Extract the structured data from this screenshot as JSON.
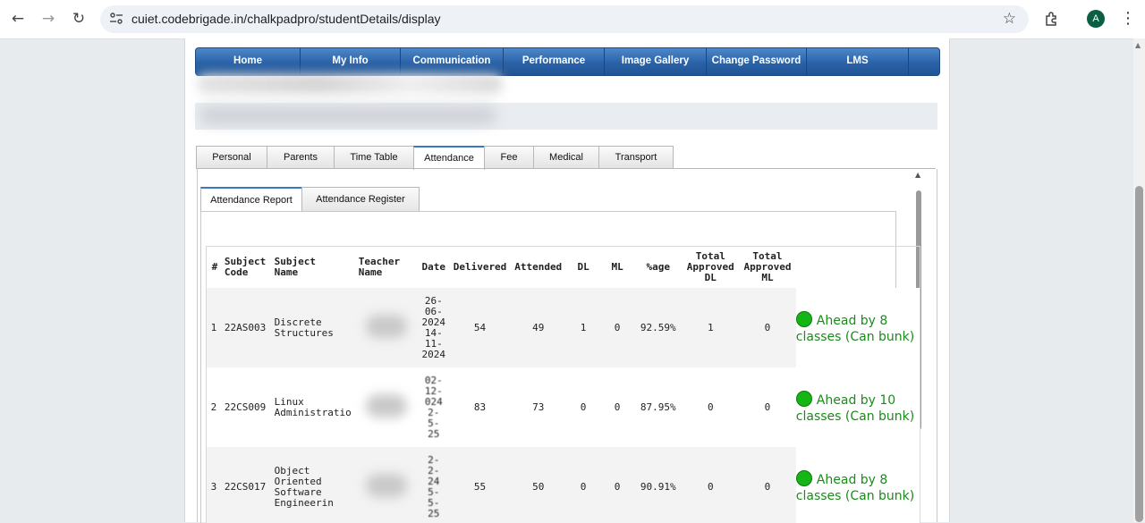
{
  "browser": {
    "url": "cuiet.codebrigade.in/chalkpadpro/studentDetails/display",
    "avatar_letter": "A"
  },
  "menu": [
    "Home",
    "My Info",
    "Communication",
    "Performance",
    "Image Gallery",
    "Change Password",
    "LMS"
  ],
  "tabs": [
    "Personal",
    "Parents",
    "Time Table",
    "Attendance",
    "Fee",
    "Medical",
    "Transport"
  ],
  "active_tab": "Attendance",
  "subtabs": [
    "Attendance Report",
    "Attendance Register"
  ],
  "table": {
    "headers": {
      "num": "#",
      "code": [
        "Subject",
        "Code"
      ],
      "name": [
        "Subject",
        "Name"
      ],
      "teacher": [
        "Teacher",
        "Name"
      ],
      "date": "Date",
      "delivered": "Delivered",
      "attended": "Attended",
      "dl": "DL",
      "ml": "ML",
      "pct": "%age",
      "tdl": [
        "Total",
        "Approved",
        "DL"
      ],
      "tml": [
        "Total",
        "Approved",
        "ML"
      ]
    },
    "rows": [
      {
        "num": "1",
        "code": "22AS003",
        "name": [
          "Discrete",
          "Structures"
        ],
        "date": [
          "26-",
          "06-",
          "2024",
          "14-",
          "11-",
          "2024"
        ],
        "delivered": "54",
        "attended": "49",
        "dl": "1",
        "ml": "0",
        "pct": "92.59%",
        "tdl": "1",
        "tml": "0",
        "status": [
          "Ahead by 8",
          "classes (Can bunk)"
        ]
      },
      {
        "num": "2",
        "code": "22CS009",
        "name": [
          "Linux",
          "Administratio"
        ],
        "date": [
          "02-",
          "12-",
          "024",
          "2-",
          "5-",
          "25"
        ],
        "delivered": "83",
        "attended": "73",
        "dl": "0",
        "ml": "0",
        "pct": "87.95%",
        "tdl": "0",
        "tml": "0",
        "status": [
          "Ahead by 10",
          "classes (Can bunk)"
        ]
      },
      {
        "num": "3",
        "code": "22CS017",
        "name": [
          "Object",
          "Oriented",
          "Software",
          "Engineerin"
        ],
        "date": [
          "2-",
          "2-",
          "24",
          "5-",
          "5-",
          "25"
        ],
        "delivered": "55",
        "attended": "50",
        "dl": "0",
        "ml": "0",
        "pct": "90.91%",
        "tdl": "0",
        "tml": "0",
        "status": [
          "Ahead by 8",
          "classes (Can bunk)"
        ]
      }
    ]
  }
}
